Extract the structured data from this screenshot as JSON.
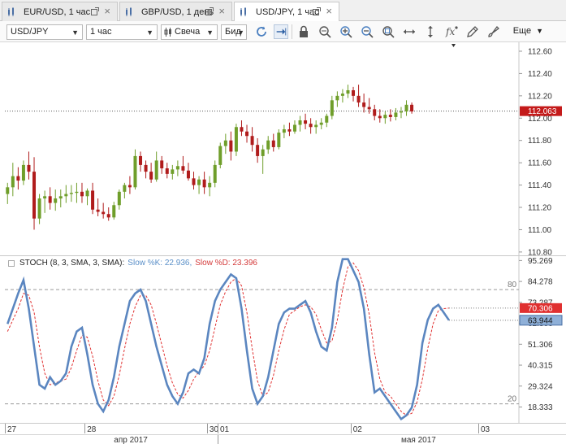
{
  "tabs": [
    {
      "label": "EUR/USD, 1 час",
      "active": false
    },
    {
      "label": "GBP/USD, 1 день",
      "active": false
    },
    {
      "label": "USD/JPY, 1 час",
      "active": true
    }
  ],
  "toolbar": {
    "symbol": "USD/JPY",
    "timeframe": "1 час",
    "chart_type": "Свеча",
    "price_type": "Бид",
    "more_label": "Еще"
  },
  "main_chart": {
    "y_ticks": [
      "112.60",
      "112.40",
      "112.20",
      "112.00",
      "111.80",
      "111.60",
      "111.40",
      "111.20",
      "111.00",
      "110.80"
    ],
    "current_price": "112.063",
    "current_value": 112.063,
    "colors": {
      "up": "#6f9e2a",
      "down": "#b01c1c",
      "price_badge": "#c41a1a"
    }
  },
  "stochastic": {
    "legend_name": "STOCH (8, 3, SMA, 3, SMA):",
    "k_label": "Slow %K: 22.936,",
    "d_label": "Slow %D: 23.396",
    "y_ticks": [
      "95.269",
      "84.278",
      "73.287",
      "62.306",
      "51.306",
      "40.315",
      "29.324",
      "18.333"
    ],
    "level_80_label": "80",
    "level_20_label": "20",
    "k_badge": "63.944",
    "d_badge": "70.306",
    "colors": {
      "k": "#5b86c0",
      "d": "#e03030"
    }
  },
  "time_axis": {
    "days": [
      {
        "label": "27",
        "i": 0
      },
      {
        "label": "28",
        "i": 15
      },
      {
        "label": "30",
        "i": 38
      },
      {
        "label": "01",
        "i": 40
      },
      {
        "label": "02",
        "i": 65
      },
      {
        "label": "03",
        "i": 89
      }
    ],
    "months": [
      {
        "label": "апр 2017",
        "i": 20
      },
      {
        "label": "мая 2017",
        "i": 74
      }
    ]
  },
  "chart_data": [
    {
      "type": "candlestick",
      "title": "USD/JPY, 1 час",
      "ylim": [
        110.77,
        112.68
      ],
      "candles": [
        [
          111.32,
          111.42,
          111.23,
          111.38
        ],
        [
          111.38,
          111.6,
          111.3,
          111.48
        ],
        [
          111.48,
          111.56,
          111.36,
          111.44
        ],
        [
          111.44,
          111.62,
          111.4,
          111.58
        ],
        [
          111.58,
          111.7,
          111.45,
          111.52
        ],
        [
          111.52,
          111.65,
          111.0,
          111.1
        ],
        [
          111.1,
          111.32,
          111.05,
          111.28
        ],
        [
          111.28,
          111.35,
          111.15,
          111.3
        ],
        [
          111.3,
          111.38,
          111.18,
          111.24
        ],
        [
          111.24,
          111.36,
          111.17,
          111.28
        ],
        [
          111.28,
          111.36,
          111.2,
          111.3
        ],
        [
          111.3,
          111.4,
          111.24,
          111.32
        ],
        [
          111.32,
          111.4,
          111.25,
          111.33
        ],
        [
          111.33,
          111.42,
          111.24,
          111.34
        ],
        [
          111.34,
          111.42,
          111.24,
          111.3
        ],
        [
          111.3,
          111.37,
          111.22,
          111.35
        ],
        [
          111.35,
          111.42,
          111.14,
          111.18
        ],
        [
          111.18,
          111.28,
          111.12,
          111.16
        ],
        [
          111.16,
          111.24,
          111.1,
          111.14
        ],
        [
          111.14,
          111.2,
          111.08,
          111.11
        ],
        [
          111.11,
          111.25,
          111.09,
          111.22
        ],
        [
          111.22,
          111.36,
          111.18,
          111.34
        ],
        [
          111.34,
          111.42,
          111.28,
          111.4
        ],
        [
          111.4,
          111.48,
          111.32,
          111.38
        ],
        [
          111.38,
          111.72,
          111.36,
          111.66
        ],
        [
          111.66,
          111.7,
          111.52,
          111.58
        ],
        [
          111.58,
          111.62,
          111.46,
          111.52
        ],
        [
          111.52,
          111.6,
          111.42,
          111.45
        ],
        [
          111.45,
          111.7,
          111.43,
          111.62
        ],
        [
          111.62,
          111.66,
          111.5,
          111.55
        ],
        [
          111.55,
          111.6,
          111.46,
          111.5
        ],
        [
          111.5,
          111.58,
          111.45,
          111.54
        ],
        [
          111.54,
          111.62,
          111.48,
          111.57
        ],
        [
          111.57,
          111.66,
          111.5,
          111.53
        ],
        [
          111.53,
          111.6,
          111.44,
          111.46
        ],
        [
          111.46,
          111.52,
          111.36,
          111.4
        ],
        [
          111.4,
          111.48,
          111.32,
          111.45
        ],
        [
          111.45,
          111.52,
          111.32,
          111.38
        ],
        [
          111.38,
          111.48,
          111.3,
          111.42
        ],
        [
          111.42,
          111.62,
          111.38,
          111.58
        ],
        [
          111.58,
          111.78,
          111.55,
          111.75
        ],
        [
          111.75,
          111.86,
          111.68,
          111.8
        ],
        [
          111.8,
          111.88,
          111.62,
          111.7
        ],
        [
          111.7,
          111.95,
          111.66,
          111.92
        ],
        [
          111.92,
          111.98,
          111.84,
          111.88
        ],
        [
          111.88,
          111.94,
          111.78,
          111.84
        ],
        [
          111.84,
          111.92,
          111.7,
          111.76
        ],
        [
          111.76,
          111.82,
          111.6,
          111.66
        ],
        [
          111.66,
          111.76,
          111.5,
          111.72
        ],
        [
          111.72,
          111.84,
          111.68,
          111.8
        ],
        [
          111.8,
          111.86,
          111.7,
          111.74
        ],
        [
          111.74,
          111.9,
          111.72,
          111.87
        ],
        [
          111.87,
          111.94,
          111.82,
          111.9
        ],
        [
          111.9,
          111.96,
          111.84,
          111.88
        ],
        [
          111.88,
          111.98,
          111.86,
          111.94
        ],
        [
          111.94,
          112.02,
          111.88,
          111.98
        ],
        [
          111.98,
          112.04,
          111.9,
          111.95
        ],
        [
          111.95,
          112.0,
          111.86,
          111.92
        ],
        [
          111.92,
          111.98,
          111.86,
          111.94
        ],
        [
          111.94,
          112.0,
          111.9,
          111.96
        ],
        [
          111.96,
          112.04,
          111.92,
          112.02
        ],
        [
          112.02,
          112.2,
          111.99,
          112.16
        ],
        [
          112.16,
          112.24,
          112.1,
          112.2
        ],
        [
          112.2,
          112.26,
          112.14,
          112.22
        ],
        [
          112.22,
          112.3,
          112.18,
          112.25
        ],
        [
          112.25,
          112.28,
          112.15,
          112.2
        ],
        [
          112.2,
          112.3,
          112.1,
          112.14
        ],
        [
          112.14,
          112.22,
          112.05,
          112.1
        ],
        [
          112.1,
          112.18,
          112.04,
          112.08
        ],
        [
          112.08,
          112.12,
          111.98,
          112.02
        ],
        [
          112.02,
          112.08,
          111.96,
          112.0
        ],
        [
          112.0,
          112.06,
          111.95,
          112.03
        ],
        [
          112.03,
          112.08,
          111.97,
          112.01
        ],
        [
          112.01,
          112.09,
          111.98,
          112.05
        ],
        [
          112.05,
          112.1,
          112.0,
          112.06
        ],
        [
          112.06,
          112.16,
          112.02,
          112.12
        ],
        [
          112.12,
          112.14,
          112.04,
          112.06
        ]
      ]
    },
    {
      "type": "line",
      "title": "STOCH (8, 3, SMA, 3, SMA)",
      "ylim": [
        10,
        98
      ],
      "levels": [
        80,
        20
      ],
      "series": [
        {
          "name": "Slow %K",
          "values": [
            62,
            70,
            78,
            85,
            70,
            50,
            30,
            28,
            34,
            30,
            32,
            36,
            50,
            58,
            60,
            46,
            30,
            20,
            16,
            22,
            34,
            50,
            62,
            74,
            78,
            80,
            74,
            62,
            50,
            40,
            30,
            24,
            20,
            26,
            36,
            38,
            36,
            44,
            62,
            74,
            80,
            84,
            88,
            86,
            70,
            48,
            28,
            20,
            24,
            34,
            48,
            62,
            68,
            70,
            70,
            72,
            74,
            68,
            58,
            50,
            48,
            60,
            84,
            96,
            96,
            90,
            84,
            70,
            46,
            26,
            28,
            24,
            20,
            16,
            12,
            14,
            18,
            30,
            52,
            64,
            70,
            72,
            68,
            63.9
          ]
        },
        {
          "name": "Slow %D",
          "values": [
            58,
            64,
            70,
            78,
            77,
            68,
            50,
            36,
            30,
            31,
            32,
            33,
            39,
            48,
            56,
            55,
            45,
            32,
            22,
            19,
            24,
            35,
            49,
            62,
            71,
            77,
            77,
            72,
            62,
            51,
            40,
            31,
            25,
            23,
            27,
            33,
            37,
            40,
            48,
            60,
            72,
            79,
            84,
            86,
            82,
            68,
            49,
            32,
            24,
            26,
            35,
            48,
            59,
            67,
            69,
            71,
            72,
            71,
            67,
            59,
            52,
            53,
            64,
            80,
            92,
            94,
            90,
            81,
            67,
            47,
            33,
            26,
            24,
            20,
            16,
            14,
            15,
            21,
            33,
            49,
            62,
            69,
            70,
            70.3
          ]
        }
      ]
    }
  ]
}
